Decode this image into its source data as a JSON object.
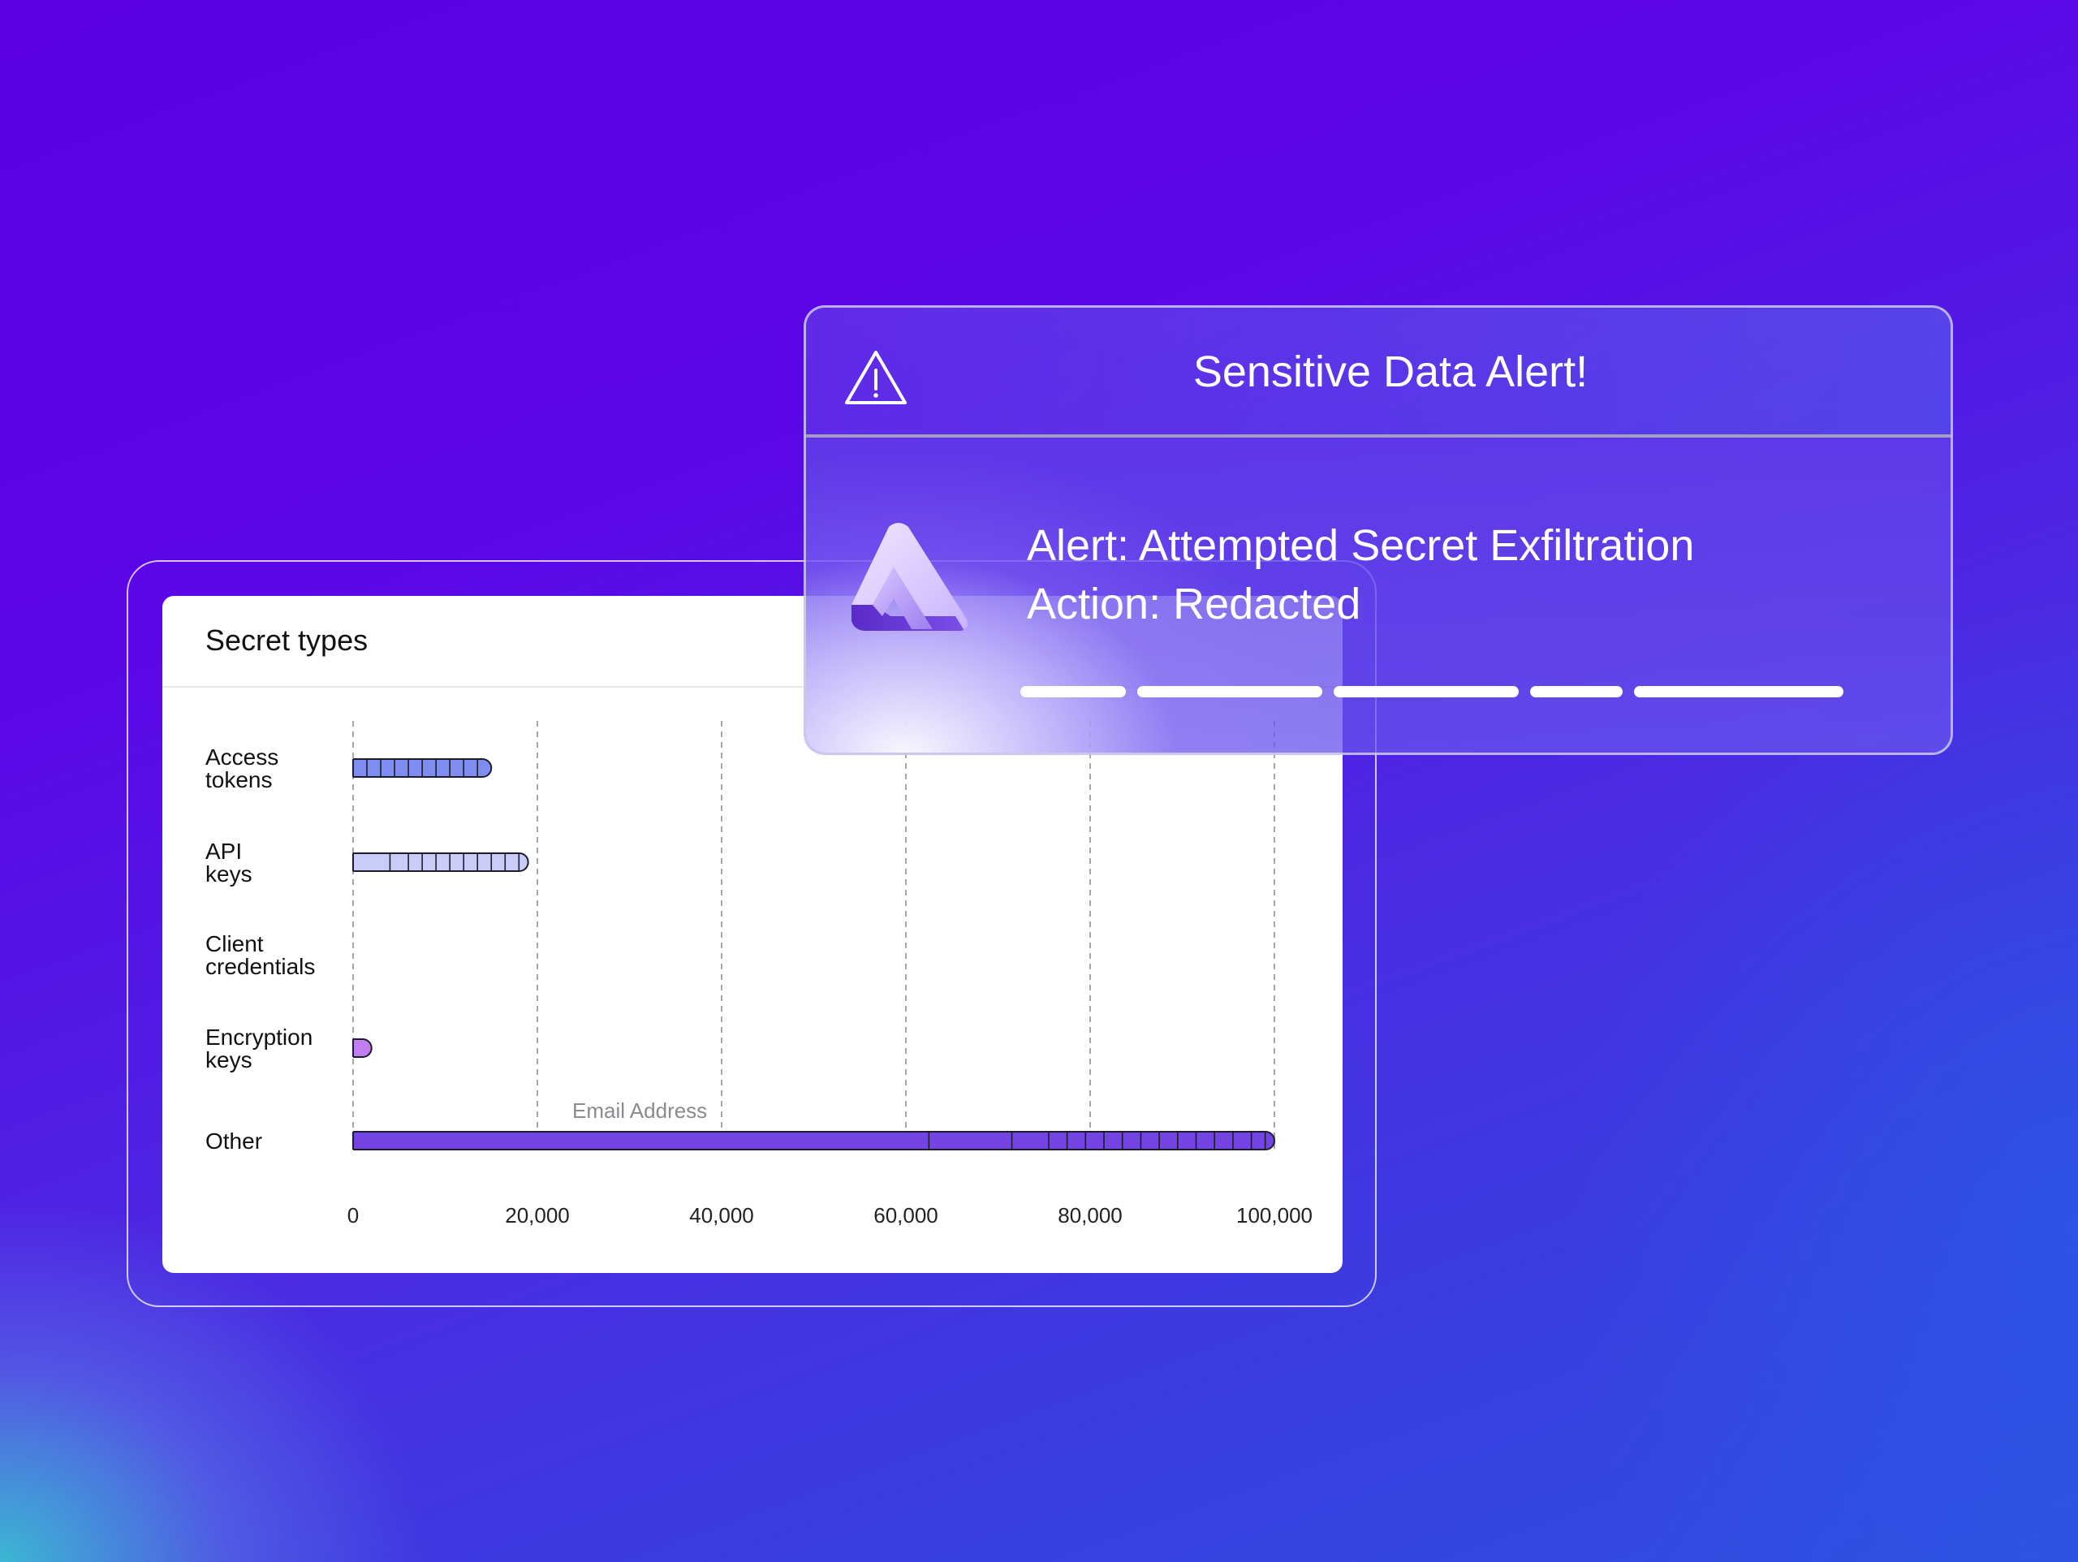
{
  "chart_card": {
    "title": "Secret types"
  },
  "chart_data": {
    "type": "bar",
    "orientation": "horizontal",
    "title": "Secret types",
    "categories": [
      "Access\ntokens",
      "API\nkeys",
      "Client\ncredentials",
      "Encryption\nkeys",
      "Other"
    ],
    "values": [
      15000,
      19000,
      0,
      2000,
      100000
    ],
    "segments": [
      [
        1500,
        3000,
        4500,
        6000,
        7500,
        9000,
        10500,
        12000,
        13500
      ],
      [
        4000,
        6000,
        7500,
        9000,
        10500,
        12000,
        13500,
        15000,
        16500,
        18000
      ],
      [],
      [],
      [
        62500,
        71500,
        75500,
        77500,
        79500,
        81500,
        83500,
        85500,
        87500,
        89500,
        91500,
        93500,
        95500,
        97500,
        99000
      ]
    ],
    "colors": [
      "#7f8df0",
      "#c9ccf7",
      "#b9a6f2",
      "#c07ef0",
      "#7344e2"
    ],
    "xticks": [
      "0",
      "20,000",
      "40,000",
      "60,000",
      "80,000",
      "100,000"
    ],
    "xtick_values": [
      0,
      20000,
      40000,
      60000,
      80000,
      100000
    ],
    "xlim": [
      0,
      100000
    ],
    "grid": "vertical dashed",
    "annotation": {
      "text": "Email Address",
      "category": "Other"
    }
  },
  "alert": {
    "title": "Sensitive Data Alert!",
    "line1": "Alert: Attempted Secret Exfiltration",
    "line2": "Action: Redacted",
    "icons": {
      "warning": "warning-triangle-icon",
      "logo": "brand-logo-icon"
    }
  },
  "colors": {
    "background": "#5a00e2",
    "accent": "#7344e2"
  }
}
